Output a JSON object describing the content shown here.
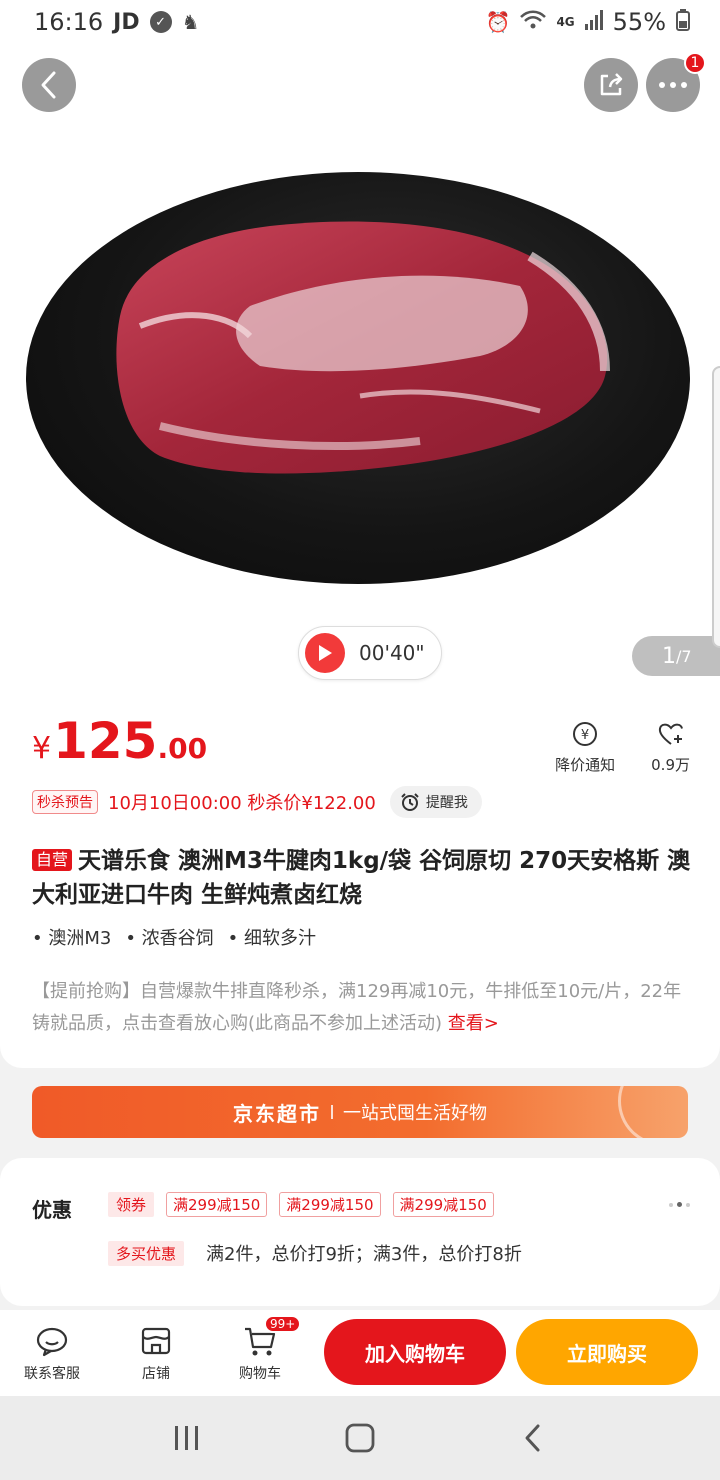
{
  "status_bar": {
    "time": "16:16",
    "app_badge": "JD",
    "network": "4G",
    "battery": "55%"
  },
  "hero": {
    "video_time": "00'40\"",
    "page_current": "1",
    "page_total": "/7",
    "more_badge": "1"
  },
  "product": {
    "price_currency": "¥",
    "price_int": "125",
    "price_dec": ".00",
    "actions": [
      {
        "label": "降价通知"
      },
      {
        "label": "0.9万"
      }
    ],
    "flash_tag": "秒杀预告",
    "flash_text": "10月10日00:00 秒杀价¥122.00",
    "remind_label": "提醒我",
    "self_tag": "自营",
    "title": "天谱乐食  澳洲M3牛腱肉1kg/袋 谷饲原切  270天安格斯 澳大利亚进口牛肉 生鲜炖煮卤红烧",
    "features": [
      "• 澳洲M3",
      "• 浓香谷饲",
      "• 细软多汁"
    ],
    "promo_text": "【提前抢购】自营爆款牛排直降秒杀，满129再减10元，牛排低至10元/片，22年铸就品质，点击查看放心购(此商品不参加上述活动)",
    "promo_link": "查看>"
  },
  "banner": {
    "title": "京东超市",
    "slogan": "一站式囤生活好物"
  },
  "coupon": {
    "label": "优惠",
    "coupon_tag": "领券",
    "coupons": [
      "满299减150",
      "满299减150",
      "满299减150"
    ],
    "multi_tag": "多买优惠",
    "multi_text": "满2件，总价打9折；满3件，总价打8折"
  },
  "bottom_bar": {
    "service": "联系客服",
    "store": "店铺",
    "cart": "购物车",
    "cart_badge": "99+",
    "add_cart": "加入购物车",
    "buy_now": "立即购买"
  },
  "colors": {
    "accent_red": "#e4161c",
    "buy_orange": "#ffa600",
    "banner_orange": "#f05a28"
  }
}
